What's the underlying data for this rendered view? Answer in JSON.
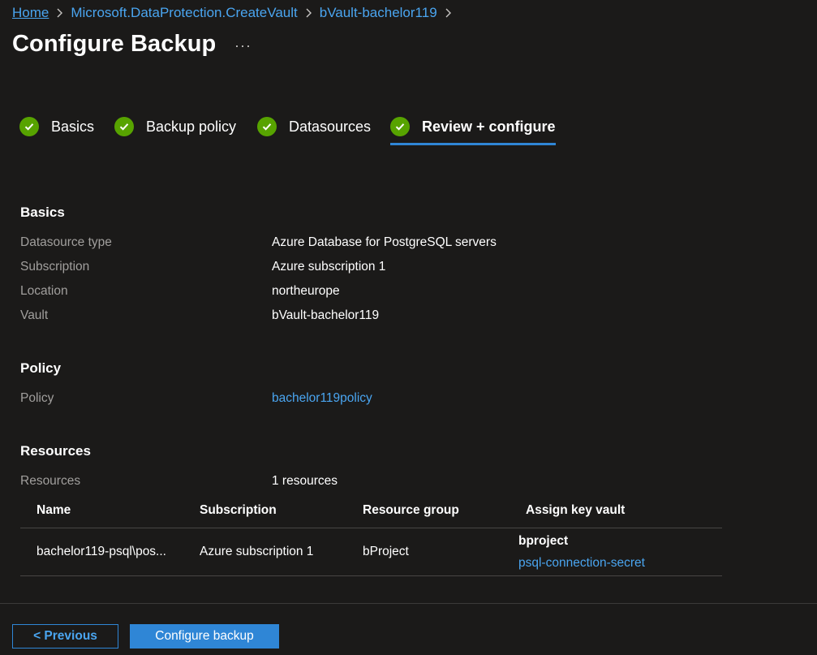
{
  "breadcrumb": {
    "items": [
      "Home",
      "Microsoft.DataProtection.CreateVault",
      "bVault-bachelor119"
    ]
  },
  "page": {
    "title": "Configure Backup",
    "more": "···"
  },
  "tabs": [
    {
      "label": "Basics",
      "state": "complete"
    },
    {
      "label": "Backup policy",
      "state": "complete"
    },
    {
      "label": "Datasources",
      "state": "complete"
    },
    {
      "label": "Review + configure",
      "state": "active"
    }
  ],
  "basics": {
    "title": "Basics",
    "rows": [
      {
        "label": "Datasource type",
        "value": "Azure Database for PostgreSQL servers"
      },
      {
        "label": "Subscription",
        "value": "Azure subscription 1"
      },
      {
        "label": "Location",
        "value": "northeurope"
      },
      {
        "label": "Vault",
        "value": "bVault-bachelor119"
      }
    ]
  },
  "policy": {
    "title": "Policy",
    "label": "Policy",
    "value": "bachelor119policy"
  },
  "resources": {
    "title": "Resources",
    "label": "Resources",
    "value": "1 resources",
    "columns": [
      "Name",
      "Subscription",
      "Resource group",
      "Assign key vault"
    ],
    "rows": [
      {
        "name": "bachelor119-psql\\pos...",
        "subscription": "Azure subscription 1",
        "resource_group": "bProject",
        "key_vault": "bproject",
        "secret": "psql-connection-secret"
      }
    ]
  },
  "footer": {
    "previous_label": "< Previous",
    "configure_label": "Configure backup"
  },
  "colors": {
    "background": "#1b1a19",
    "link": "#4aa5f0",
    "accent": "#2f86d6",
    "success": "#57a300",
    "muted_text": "#a19f9d"
  },
  "icons": [
    "chevron-right-icon",
    "check-circle-icon",
    "more-icon"
  ]
}
